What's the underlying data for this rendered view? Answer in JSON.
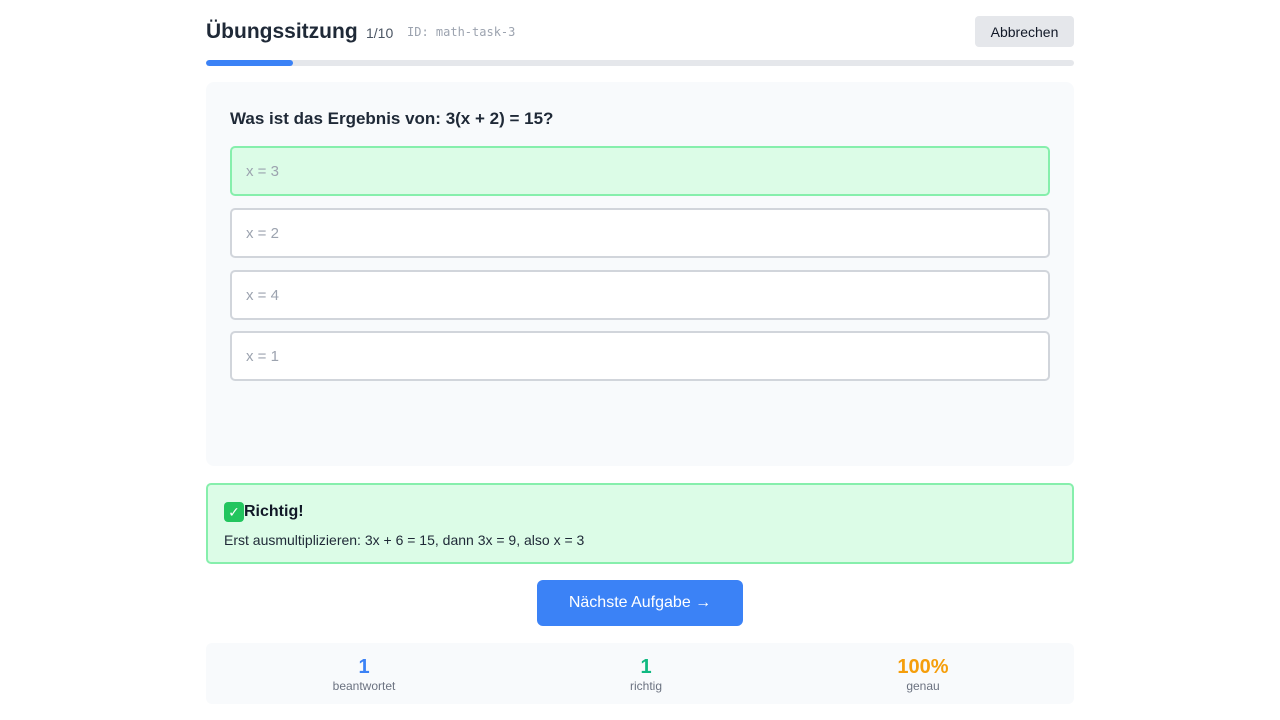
{
  "header": {
    "title": "Übungssitzung",
    "counter": "1/10",
    "task_id": "ID: math-task-3",
    "cancel_label": "Abbrechen"
  },
  "progress": {
    "fraction": 0.1,
    "color": "#3b82f6"
  },
  "question": {
    "text": "Was ist das Ergebnis von: 3(x + 2) = 15?",
    "options": [
      {
        "label": "x = 3",
        "state": "correct"
      },
      {
        "label": "x = 2",
        "state": "default"
      },
      {
        "label": "x = 4",
        "state": "default"
      },
      {
        "label": "x = 1",
        "state": "default"
      }
    ]
  },
  "feedback": {
    "icon": "check-mark-icon",
    "title": "Richtig!",
    "explanation": "Erst ausmultiplizieren: 3x + 6 = 15, dann 3x = 9, also x = 3"
  },
  "next_label": "Nächste Aufgabe →",
  "stats": [
    {
      "value": "1",
      "label": "beantwortet",
      "color": "#3b82f6"
    },
    {
      "value": "1",
      "label": "richtig",
      "color": "#10b981"
    },
    {
      "value": "100%",
      "label": "genau",
      "color": "#f59e0b"
    }
  ],
  "colors": {
    "accent": "#3b82f6",
    "correct_bg": "#dcfce7",
    "correct_border": "#86efac"
  }
}
